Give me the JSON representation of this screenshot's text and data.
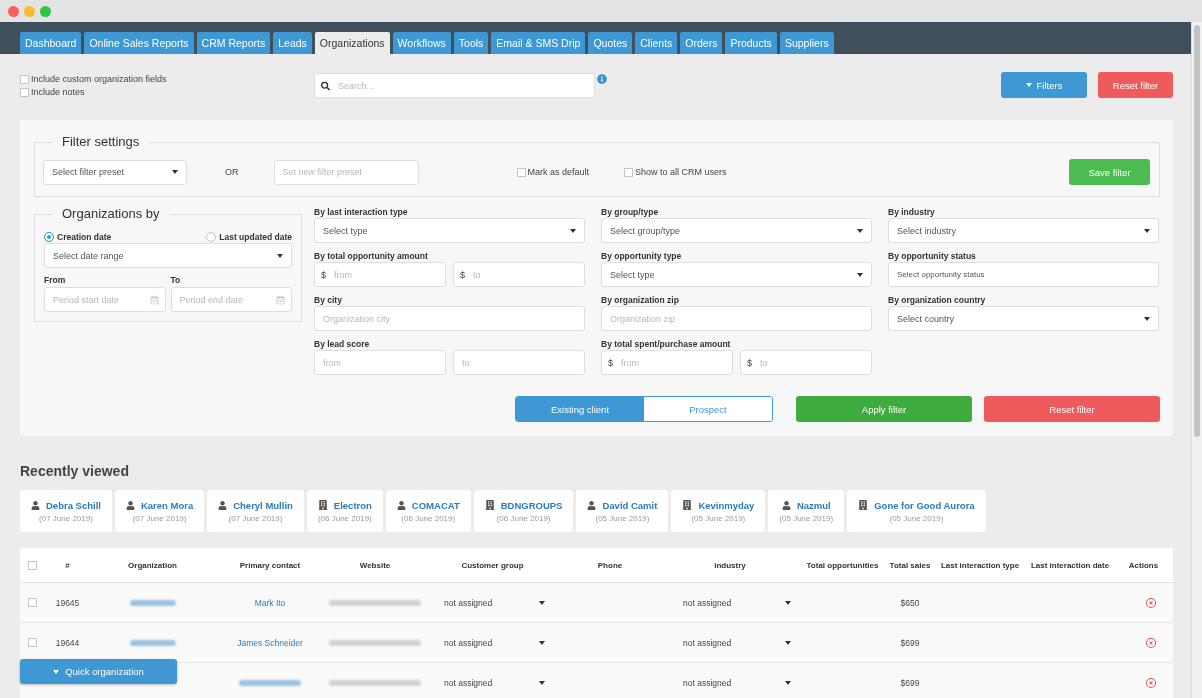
{
  "nav": {
    "tabs": [
      {
        "label": "Dashboard",
        "selected": false
      },
      {
        "label": "Online Sales Reports",
        "selected": false
      },
      {
        "label": "CRM Reports",
        "selected": false
      },
      {
        "label": "Leads",
        "selected": false
      },
      {
        "label": "Organizations",
        "selected": true
      },
      {
        "label": "Workflows",
        "selected": false
      },
      {
        "label": "Tools",
        "selected": false
      },
      {
        "label": "Email & SMS Drip",
        "selected": false
      },
      {
        "label": "Quotes",
        "selected": false
      },
      {
        "label": "Clients",
        "selected": false
      },
      {
        "label": "Orders",
        "selected": false
      },
      {
        "label": "Products",
        "selected": false
      },
      {
        "label": "Suppliers",
        "selected": false
      }
    ]
  },
  "options": [
    {
      "label": "Include custom organization fields",
      "checked": false
    },
    {
      "label": "Include notes",
      "checked": false
    }
  ],
  "search": {
    "placeholder": "Search..."
  },
  "top_buttons": [
    {
      "kind": "filters",
      "label": "Filters"
    },
    {
      "kind": "reset",
      "label": "Reset filter"
    }
  ],
  "filter_settings": {
    "legend": "Filter settings",
    "preset": {
      "value": "Select filter preset"
    },
    "or": "OR",
    "new_preset": {
      "placeholder": "Set new filter preset"
    },
    "checkboxes": [
      {
        "label": "Mark as default",
        "checked": false
      },
      {
        "label": "Show to all CRM users",
        "checked": false
      }
    ],
    "save": {
      "kind": "save",
      "label": "Save filter"
    }
  },
  "organizations_by": {
    "legend": "Organizations by",
    "date_types": [
      {
        "label": "Creation date",
        "selected": true
      },
      {
        "label": "Last updated date",
        "selected": false
      }
    ],
    "range": {
      "value": "Select date range"
    },
    "from": {
      "label": "From",
      "placeholder": "Period start date"
    },
    "to": {
      "label": "To",
      "placeholder": "Period end date"
    }
  },
  "filters": [
    {
      "label": "By last interaction type",
      "kind": "select",
      "value": "Select type"
    },
    {
      "label": "By group/type",
      "kind": "select",
      "value": "Select group/type"
    },
    {
      "label": "By industry",
      "kind": "select",
      "value": "Select industry"
    },
    {
      "label": "By total opportunity amount",
      "kind": "range",
      "inputs": [
        {
          "prefix": "$",
          "placeholder": "from"
        },
        {
          "prefix": "$",
          "placeholder": "to"
        }
      ]
    },
    {
      "label": "By opportunity type",
      "kind": "select",
      "value": "Select type"
    },
    {
      "label": "By opportunity status",
      "kind": "multiselect",
      "value": "Select opportunity status"
    },
    {
      "label": "By city",
      "kind": "text",
      "placeholder": "Organization city"
    },
    {
      "label": "By organization zip",
      "kind": "text",
      "placeholder": "Organization zip"
    },
    {
      "label": "By organization country",
      "kind": "select",
      "value": "Select country"
    },
    {
      "label": "By lead score",
      "kind": "range",
      "inputs": [
        {
          "placeholder": "from"
        },
        {
          "placeholder": "to"
        }
      ]
    },
    {
      "label": "By total spent/purchase amount",
      "kind": "range",
      "inputs": [
        {
          "prefix": "$",
          "placeholder": "from"
        },
        {
          "prefix": "$",
          "placeholder": "to"
        }
      ]
    }
  ],
  "client_type": [
    {
      "label": "Existing client",
      "selected": true
    },
    {
      "label": "Prospect",
      "selected": false
    }
  ],
  "actions": [
    {
      "kind": "apply",
      "label": "Apply filter"
    },
    {
      "kind": "reset",
      "label": "Reset filter"
    }
  ],
  "recently_viewed": {
    "title": "Recently viewed",
    "items": [
      {
        "kind": "person",
        "name": "Debra Schill",
        "date": "(07 June 2019)"
      },
      {
        "kind": "person",
        "name": "Karen Mora",
        "date": "(07 June 2019)"
      },
      {
        "kind": "person",
        "name": "Cheryl Mullin",
        "date": "(07 June 2019)"
      },
      {
        "kind": "organization",
        "name": "Electron",
        "date": "(06 June 2019)"
      },
      {
        "kind": "person",
        "name": "COMACAT",
        "date": "(06 June 2019)"
      },
      {
        "kind": "organization",
        "name": "BDNGROUPS",
        "date": "(06 June 2019)"
      },
      {
        "kind": "person",
        "name": "David Camit",
        "date": "(05 June 2019)"
      },
      {
        "kind": "organization",
        "name": "Kevinmyday",
        "date": "(05 June 2019)"
      },
      {
        "kind": "person",
        "name": "Nazmul",
        "date": "(05 June 2019)"
      },
      {
        "kind": "organization",
        "name": "Gone for Good Aurora",
        "date": "(05 June 2019)"
      }
    ]
  },
  "table": {
    "all_checked": false,
    "columns": [
      "#",
      "Organization",
      "Primary contact",
      "Website",
      "Customer group",
      "Phone",
      "industry",
      "Total opportunities",
      "Total sales",
      "Last interaction type",
      "Last interaction date",
      "Actions"
    ],
    "rows": [
      {
        "checked": false,
        "id": "19645",
        "contact": "Mark Ito",
        "customer_group": "not assigned",
        "industry": "not assigned",
        "total_sales": "$650"
      },
      {
        "checked": false,
        "id": "19644",
        "contact": "James Schneider",
        "customer_group": "not assigned",
        "industry": "not assigned",
        "total_sales": "$699"
      },
      {
        "customer_group": "not assigned",
        "industry": "not assigned",
        "total_sales": "$699"
      }
    ]
  },
  "quick_button": {
    "label": "Quick organization"
  }
}
